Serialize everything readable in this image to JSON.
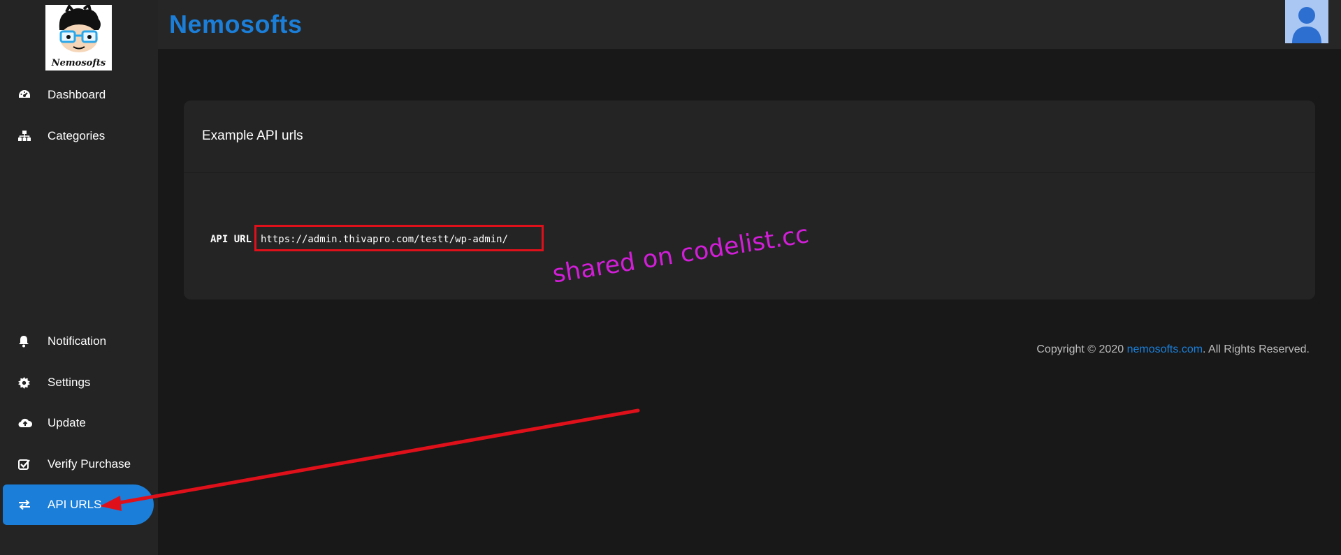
{
  "brand": "Nemosofts",
  "logo_text": "Nemosofts",
  "sidebar": {
    "items": [
      {
        "label": "Dashboard",
        "icon": "dashboard-icon"
      },
      {
        "label": "Categories",
        "icon": "sitemap-icon"
      },
      {
        "label": "Notification",
        "icon": "bell-icon"
      },
      {
        "label": "Settings",
        "icon": "gear-icon"
      },
      {
        "label": "Update",
        "icon": "cloud-upload-icon"
      },
      {
        "label": "Verify Purchase",
        "icon": "check-square-icon"
      },
      {
        "label": "API URLS",
        "icon": "exchange-icon",
        "active": true
      }
    ]
  },
  "card": {
    "title": "Example API urls",
    "api_label": "API URL",
    "api_url": "https://admin.thivapro.com/testt/wp-admin/"
  },
  "footer": {
    "prefix": "Copyright © 2020 ",
    "link": "nemosofts.com",
    "suffix": ". All Rights Reserved."
  },
  "watermark": "shared on codelist.cc",
  "colors": {
    "accent": "#1b7fd9",
    "highlight": "#e0101a",
    "watermark": "#d21ed8",
    "background": "#181818",
    "sidebar": "#242424"
  }
}
